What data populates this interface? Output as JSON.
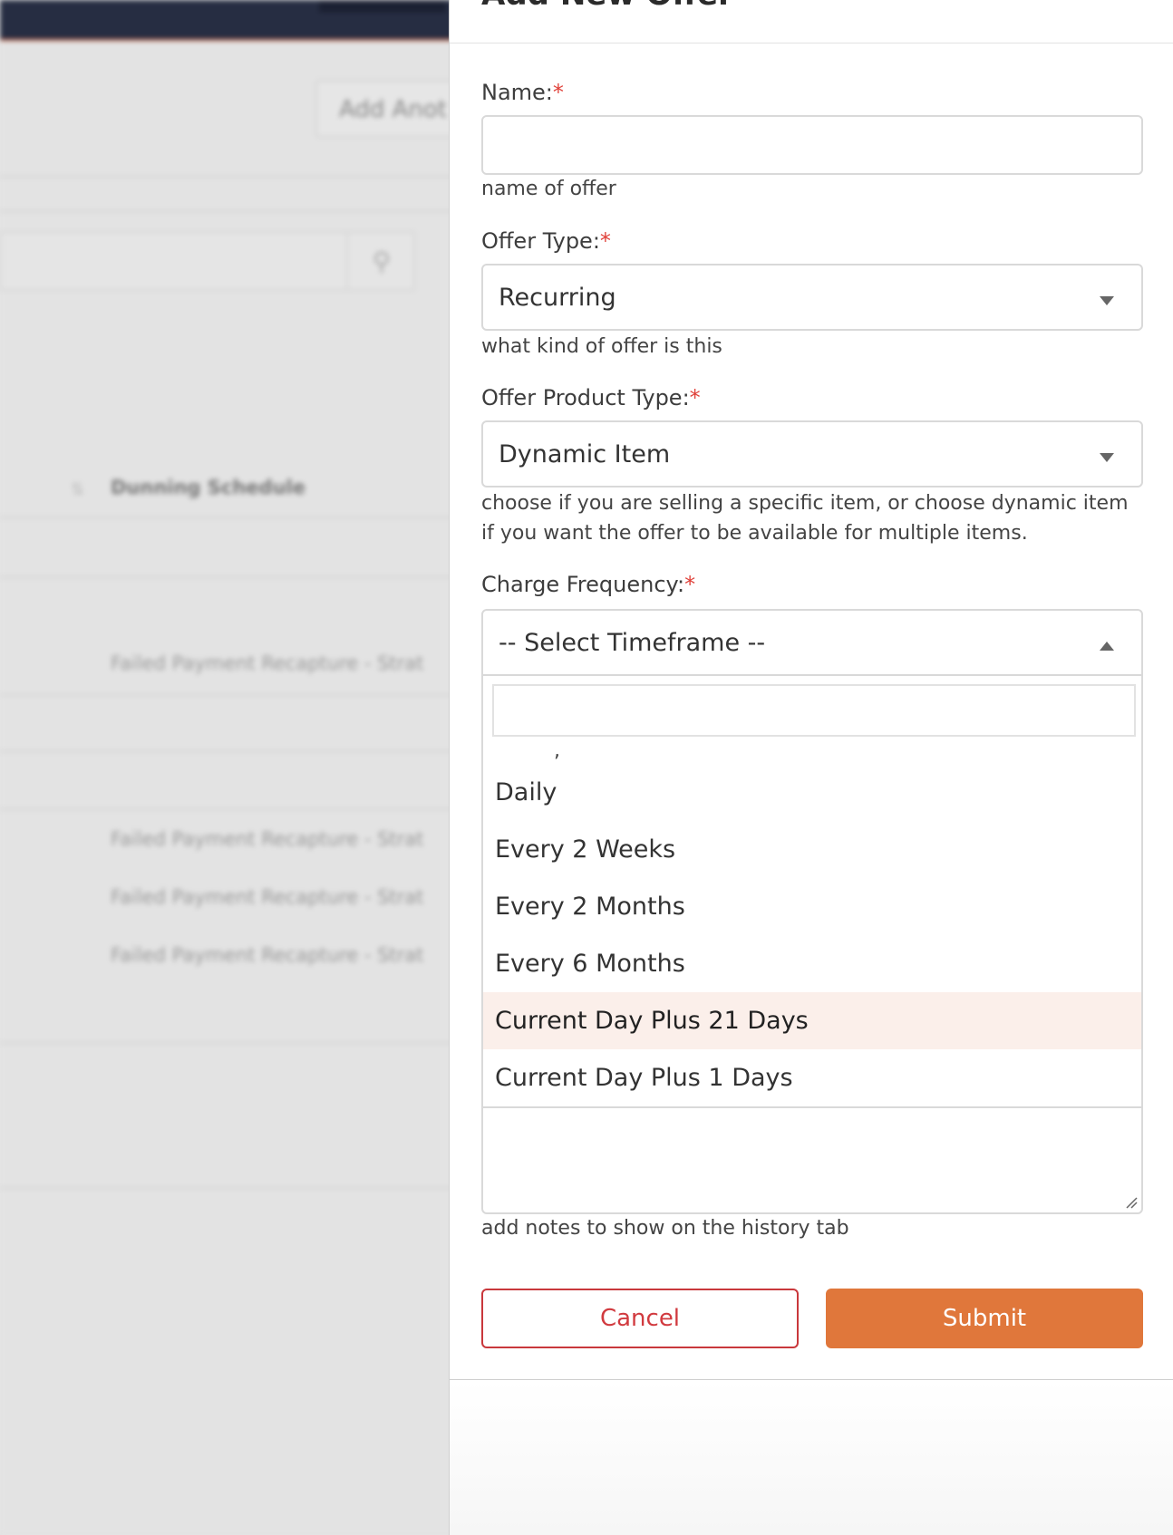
{
  "background": {
    "add_button_label": "Add Anot",
    "column_header": "Dunning Schedule",
    "rows": [
      "Failed Payment Recapture - Strat",
      "Failed Payment Recapture - Strat",
      "Failed Payment Recapture - Strat",
      "Failed Payment Recapture - Strat"
    ]
  },
  "panel": {
    "title": "Add New Offer",
    "name": {
      "label": "Name:",
      "required": "*",
      "value": "",
      "help": "name of offer"
    },
    "offer_type": {
      "label": "Offer Type:",
      "required": "*",
      "selected": "Recurring",
      "help": "what kind of offer is this"
    },
    "offer_product_type": {
      "label": "Offer Product Type:",
      "required": "*",
      "selected": "Dynamic Item",
      "help": "choose if you are selling a specific item, or choose dynamic item if you want the offer to be available for multiple items."
    },
    "charge_frequency": {
      "label": "Charge Frequency:",
      "required": "*",
      "selected": "-- Select Timeframe --",
      "search_value": "",
      "partial_option": ",",
      "options": [
        "Daily",
        "Every 2 Weeks",
        "Every 2 Months",
        "Every 6 Months",
        "Current Day Plus 21 Days",
        "Current Day Plus 1 Days"
      ],
      "highlighted_option": "Current Day Plus 21 Days"
    },
    "notes": {
      "value": "",
      "help": "add notes to show on the history tab"
    },
    "buttons": {
      "cancel": "Cancel",
      "submit": "Submit"
    }
  },
  "colors": {
    "topbar": "#262d42",
    "accent_orange": "#e0773b",
    "cancel_red": "#d13a3f",
    "required_red": "#e0413a",
    "highlight_row": "#fbefea"
  }
}
